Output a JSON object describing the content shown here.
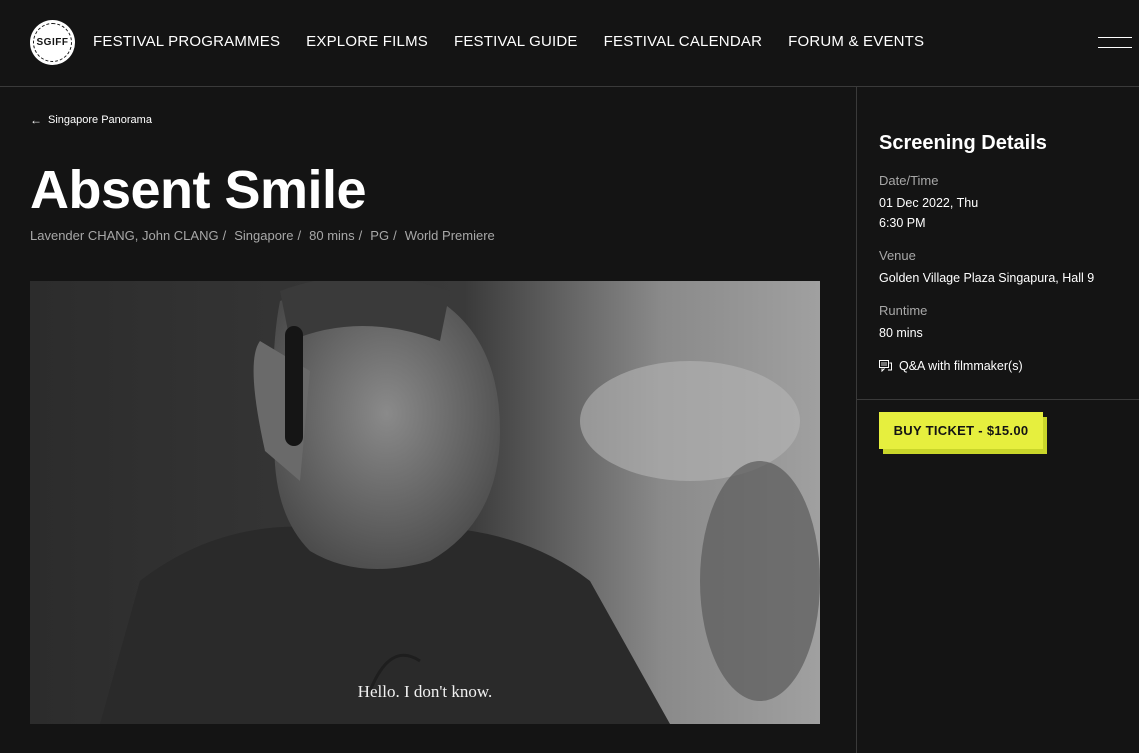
{
  "header": {
    "logo_text": "SGIFF",
    "nav": [
      {
        "label": "FESTIVAL PROGRAMMES"
      },
      {
        "label": "EXPLORE FILMS"
      },
      {
        "label": "FESTIVAL GUIDE"
      },
      {
        "label": "FESTIVAL CALENDAR"
      },
      {
        "label": "FORUM & EVENTS"
      }
    ],
    "menu_icon": "hamburger-icon"
  },
  "main": {
    "back_link": "Singapore Panorama",
    "title": "Absent Smile",
    "meta": [
      "Lavender CHANG, John CLANG",
      "Singapore",
      "80 mins",
      "PG",
      "World Premiere"
    ],
    "image_subtitle": "Hello. I don't know."
  },
  "sidebar": {
    "title": "Screening Details",
    "datetime_label": "Date/Time",
    "date": "01 Dec 2022, Thu",
    "time": "6:30 PM",
    "venue_label": "Venue",
    "venue": "Golden Village Plaza Singapura, Hall 9",
    "runtime_label": "Runtime",
    "runtime": "80 mins",
    "qa_label": "Q&A with filmmaker(s)",
    "buy_label": "BUY TICKET - $15.00"
  },
  "colors": {
    "background": "#141414",
    "accent": "#e6ef3e",
    "muted_text": "#a8a8a8"
  }
}
